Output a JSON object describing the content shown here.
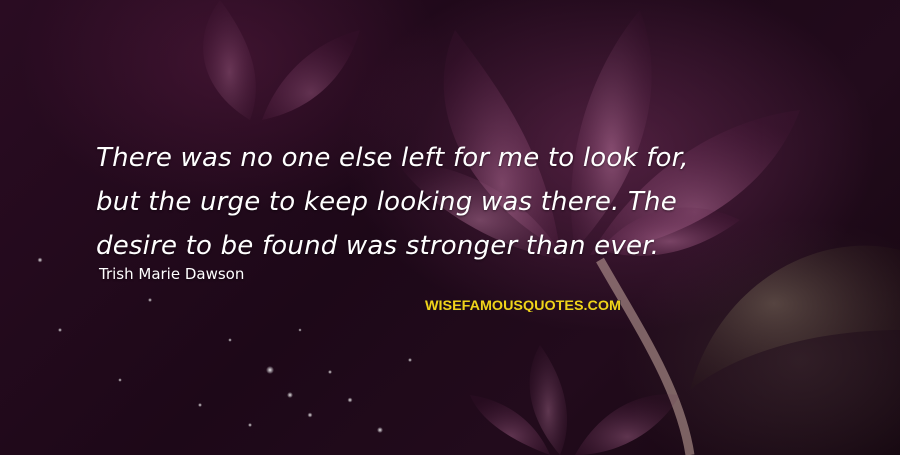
{
  "quote": {
    "lines": [
      "There was no one else left for me to look for,",
      "but the urge to keep looking was there. The",
      "desire to be found was stronger than ever."
    ]
  },
  "author": "Trish Marie Dawson",
  "watermark": {
    "text": "WISEFAMOUSQUOTES.COM",
    "fill_color": "#f2d21a",
    "outline_color": "#1a1a1a"
  },
  "colors": {
    "background": "#1d0818",
    "text": "#ffffff",
    "flower": "#a85a8a"
  }
}
